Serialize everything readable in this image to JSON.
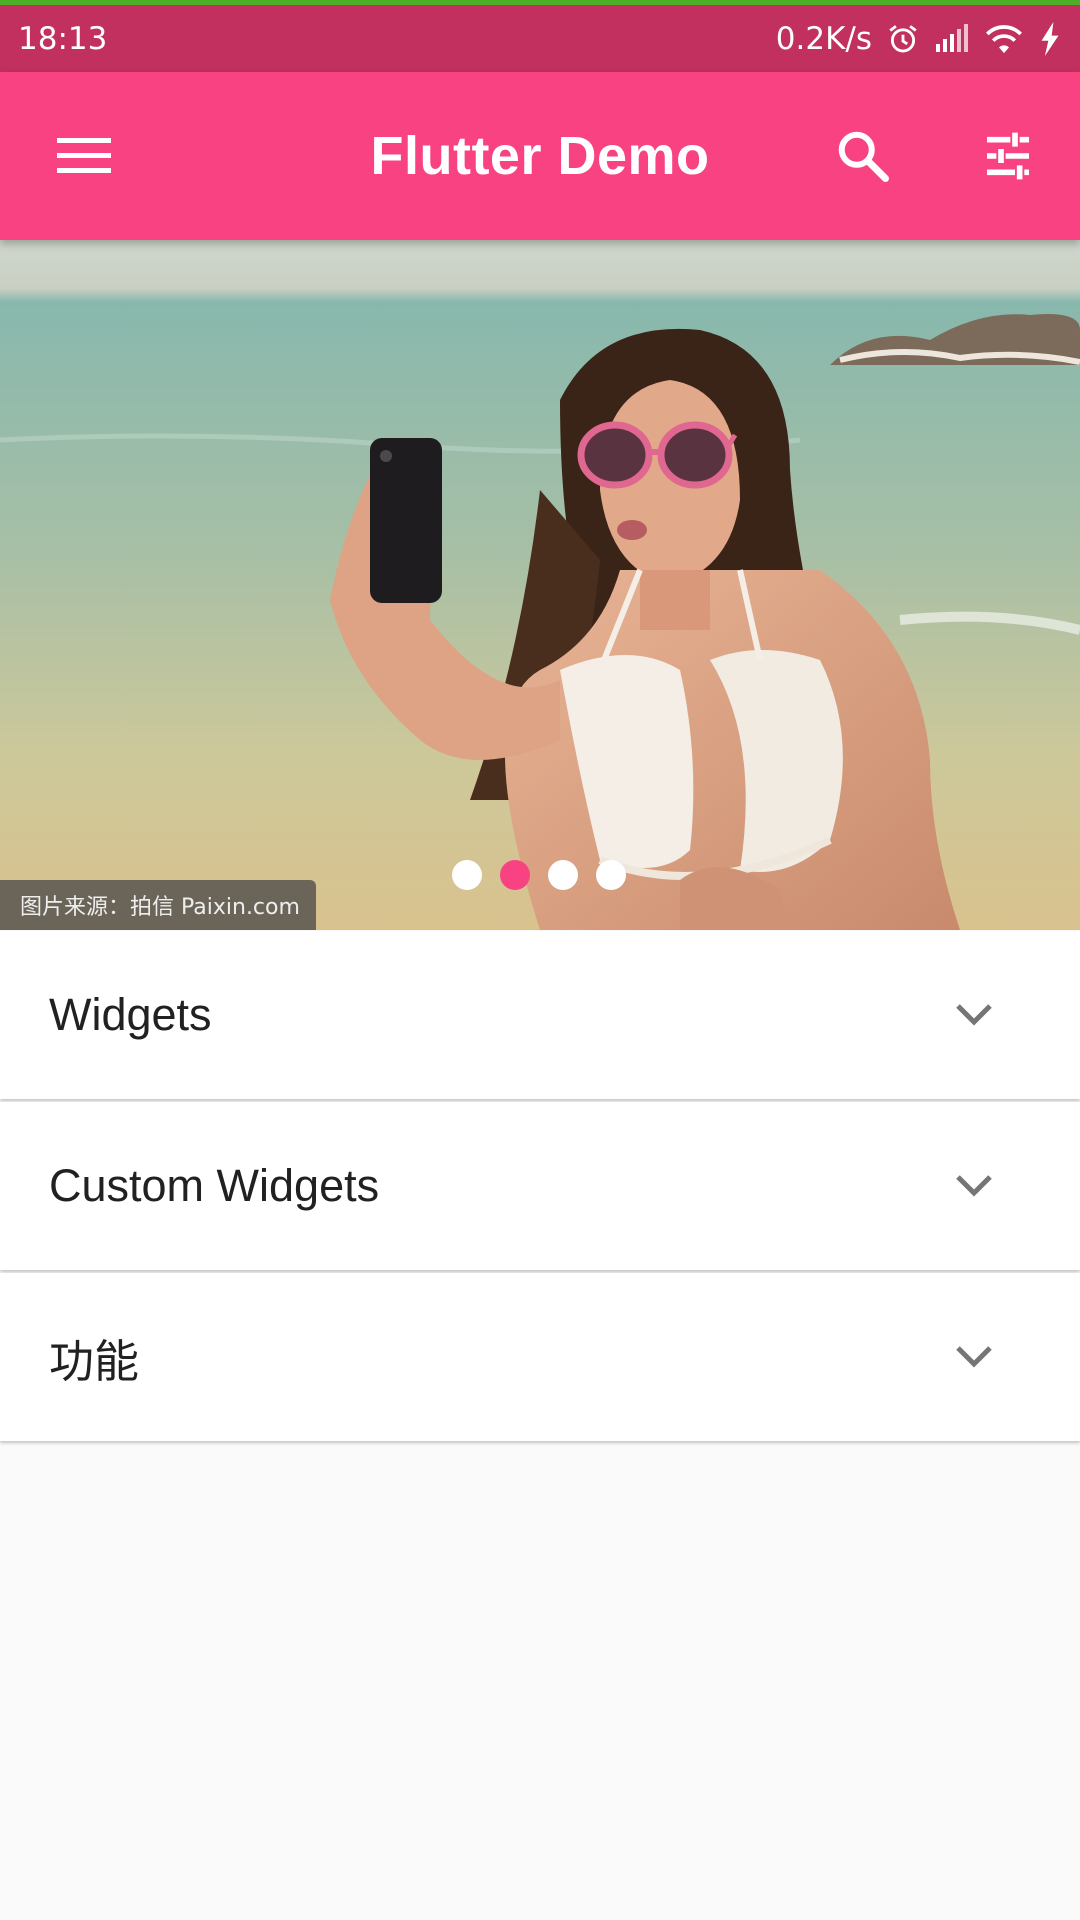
{
  "status_bar": {
    "time": "18:13",
    "net_speed": "0.2K/s",
    "icons": [
      "alarm-icon",
      "signal-icon",
      "wifi-icon",
      "charging-icon"
    ]
  },
  "app_bar": {
    "title": "Flutter Demo",
    "color": "#f94281",
    "icons": [
      "menu-icon",
      "search-icon",
      "tune-icon"
    ]
  },
  "carousel": {
    "caption": "图片来源：拍信 Paixin.com",
    "page_count": 4,
    "active_index": 1
  },
  "sections": [
    {
      "label": "Widgets"
    },
    {
      "label": "Custom Widgets"
    },
    {
      "label": "功能"
    }
  ],
  "colors": {
    "accent": "#f94281",
    "status_bar": "#c2305f",
    "background": "#fafafa"
  }
}
